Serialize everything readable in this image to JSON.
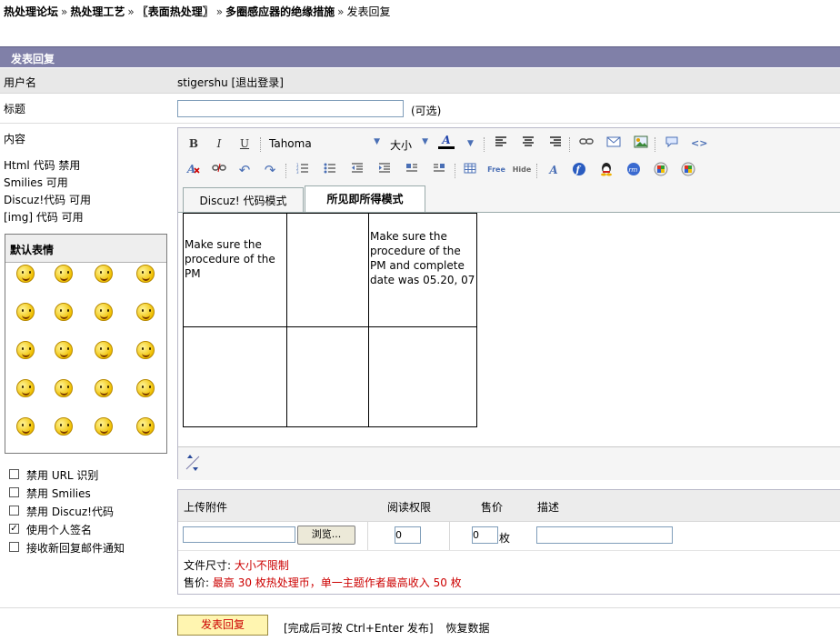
{
  "breadcrumb": {
    "items": [
      "热处理论坛",
      "热处理工艺",
      "〖表面热处理〗",
      "多圈感应器的绝缘措施"
    ],
    "current": "发表回复",
    "separator": "»"
  },
  "title_bar": "发表回复",
  "form": {
    "username_label": "用户名",
    "username_value": "stigershu",
    "logout_link": "[退出登录]",
    "subject_label": "标题",
    "subject_value": "",
    "subject_optional": "(可选)",
    "content_label": "内容",
    "options": [
      {
        "name": "Html",
        "text": "代码 禁用"
      },
      {
        "name": "Smilies",
        "text": "可用"
      },
      {
        "name": "Discuz!代码",
        "text": "可用"
      },
      {
        "name": "[img]",
        "text": "代码 可用"
      }
    ]
  },
  "smilies": {
    "title": "默认表情",
    "count": 20
  },
  "checkboxes": [
    {
      "label": "禁用 URL 识别",
      "checked": false
    },
    {
      "label": "禁用 Smilies",
      "checked": false
    },
    {
      "label": "禁用 Discuz!代码",
      "checked": false
    },
    {
      "label": "使用个人签名",
      "checked": true
    },
    {
      "label": "接收新回复邮件通知",
      "checked": false
    }
  ],
  "toolbar": {
    "bold": "B",
    "italic": "I",
    "underline": "U",
    "font_name": "Tahoma",
    "font_size": "大小",
    "color_letter": "A",
    "free_label": "Free",
    "hide_label": "Hide"
  },
  "editor_tabs": [
    {
      "label": "Discuz! 代码模式",
      "active": false
    },
    {
      "label": "所见即所得模式",
      "active": true
    }
  ],
  "editor_table": {
    "rows": [
      [
        "Make sure the procedure of the PM",
        "",
        "Make sure the procedure of the PM  and complete date was 05.20, 07"
      ],
      [
        "",
        "",
        ""
      ]
    ]
  },
  "attachments": {
    "headers": {
      "upload": "上传附件",
      "permission": "阅读权限",
      "price": "售价",
      "description": "描述"
    },
    "browse_button": "浏览...",
    "permission_value": "0",
    "price_value": "0",
    "price_unit": "枚",
    "file_size_label": "文件尺寸:",
    "file_size_value": "大小不限制",
    "price_label": "售价:",
    "price_note": "最高 30 枚热处理币，单一主题作者最高收入 50 枚"
  },
  "submit": {
    "button": "发表回复",
    "hint": "[完成后可按 Ctrl+Enter 发布]",
    "restore": "恢复数据"
  }
}
